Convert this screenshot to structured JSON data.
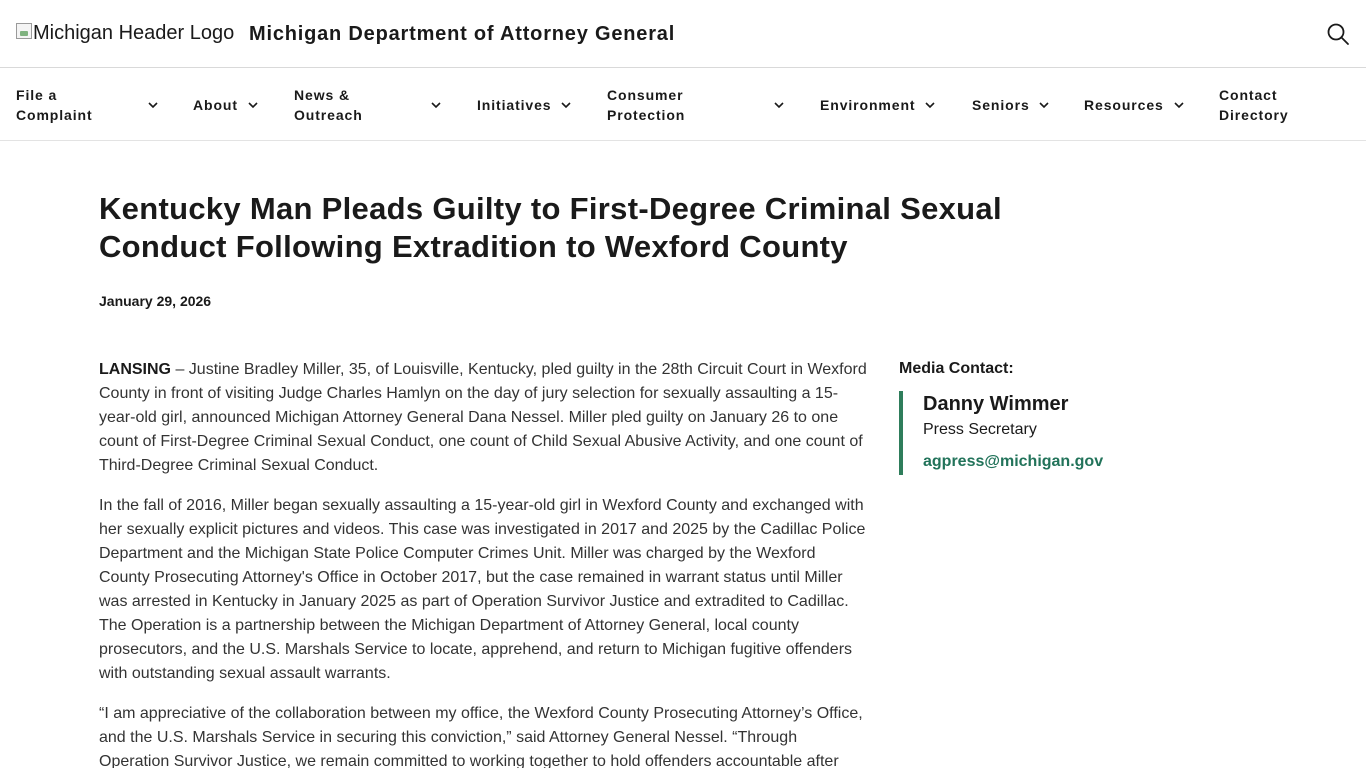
{
  "header": {
    "logo_alt": "Michigan Header Logo",
    "site_title": "Michigan Department of Attorney General",
    "search_icon": "search-icon"
  },
  "nav": {
    "items": [
      {
        "label": "File a\nComplaint",
        "has_dropdown": true
      },
      {
        "label": "About",
        "has_dropdown": true
      },
      {
        "label": "News &\nOutreach",
        "has_dropdown": true
      },
      {
        "label": "Initiatives",
        "has_dropdown": true
      },
      {
        "label": "Consumer\nProtection",
        "has_dropdown": true
      },
      {
        "label": "Environment",
        "has_dropdown": true
      },
      {
        "label": "Seniors",
        "has_dropdown": true
      },
      {
        "label": "Resources",
        "has_dropdown": true
      },
      {
        "label": "Contact\nDirectory",
        "has_dropdown": false
      }
    ]
  },
  "article": {
    "title": "Kentucky Man Pleads Guilty to First-Degree Criminal Sexual Conduct Following Extradition to Wexford County",
    "date": "January 29, 2026",
    "dateline": "LANSING",
    "p1_rest": " – Justine Bradley Miller, 35, of Louisville, Kentucky, pled guilty in the 28th Circuit Court in Wexford County in front of visiting Judge Charles Hamlyn on the day of jury selection for sexually assaulting a 15-year-old girl, announced Michigan Attorney General Dana Nessel. Miller pled guilty on January 26 to one count of First-Degree Criminal Sexual Conduct, one count of Child Sexual Abusive Activity, and one count of Third-Degree Criminal Sexual Conduct.",
    "p2": "In the fall of 2016, Miller began sexually assaulting a 15-year-old girl in Wexford County and exchanged with her sexually explicit pictures and videos. This case was investigated in 2017 and 2025 by the Cadillac Police Department and the Michigan State Police Computer Crimes Unit. Miller was charged by the Wexford County Prosecuting Attorney's Office in October 2017, but the case remained in warrant status until Miller was arrested in Kentucky in January 2025 as part of Operation Survivor Justice and extradited to Cadillac. The Operation is a partnership between the Michigan Department of Attorney General, local county prosecutors, and the U.S. Marshals Service to locate, apprehend, and return to Michigan fugitive offenders with outstanding sexual assault warrants.",
    "p3": "“I am appreciative of the collaboration between my office, the Wexford County Prosecuting Attorney’s Office, and the U.S. Marshals Service in securing this conviction,” said Attorney General Nessel. “Through Operation Survivor Justice, we remain committed to working together to hold offenders accountable after"
  },
  "media_contact": {
    "label": "Media Contact:",
    "name": "Danny Wimmer",
    "role": "Press Secretary",
    "email": "agpress@michigan.gov"
  },
  "colors": {
    "accent": "#2e7d5b",
    "link": "#22735a"
  }
}
